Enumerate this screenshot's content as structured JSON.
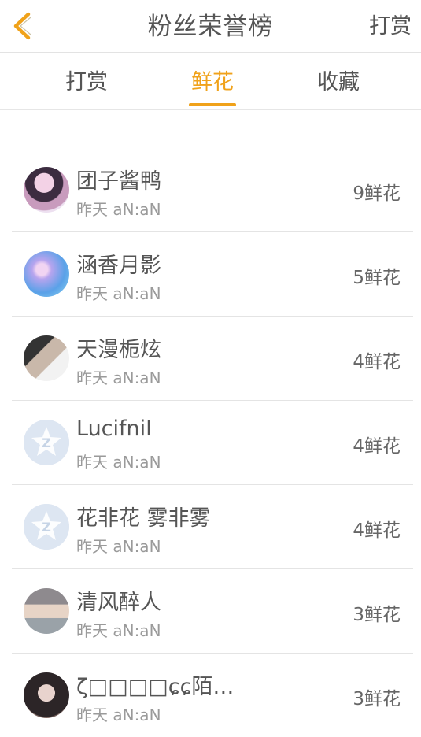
{
  "header": {
    "title": "粉丝荣誉榜",
    "right_action": "打赏",
    "back_icon": "chevron-left-icon",
    "accent_color": "#f0a21a"
  },
  "tabs": [
    {
      "label": "打赏",
      "active": false
    },
    {
      "label": "鲜花",
      "active": true
    },
    {
      "label": "收藏",
      "active": false
    }
  ],
  "list": [
    {
      "name": "团子酱鸭",
      "time": "昨天 aN:aN",
      "count": "9鲜花"
    },
    {
      "name": "涵香月影",
      "time": "昨天 aN:aN",
      "count": "5鲜花"
    },
    {
      "name": "天漫栀炫",
      "time": "昨天 aN:aN",
      "count": "4鲜花"
    },
    {
      "name": "LucifniI",
      "time": "昨天 aN:aN",
      "count": "4鲜花"
    },
    {
      "name": "花非花 雾非雾",
      "time": "昨天 aN:aN",
      "count": "4鲜花"
    },
    {
      "name": "清风醉人",
      "time": "昨天 aN:aN",
      "count": "3鲜花"
    },
    {
      "name": "ζ□□□□ɕɕ陌…",
      "time": "昨天 aN:aN",
      "count": "3鲜花"
    }
  ]
}
